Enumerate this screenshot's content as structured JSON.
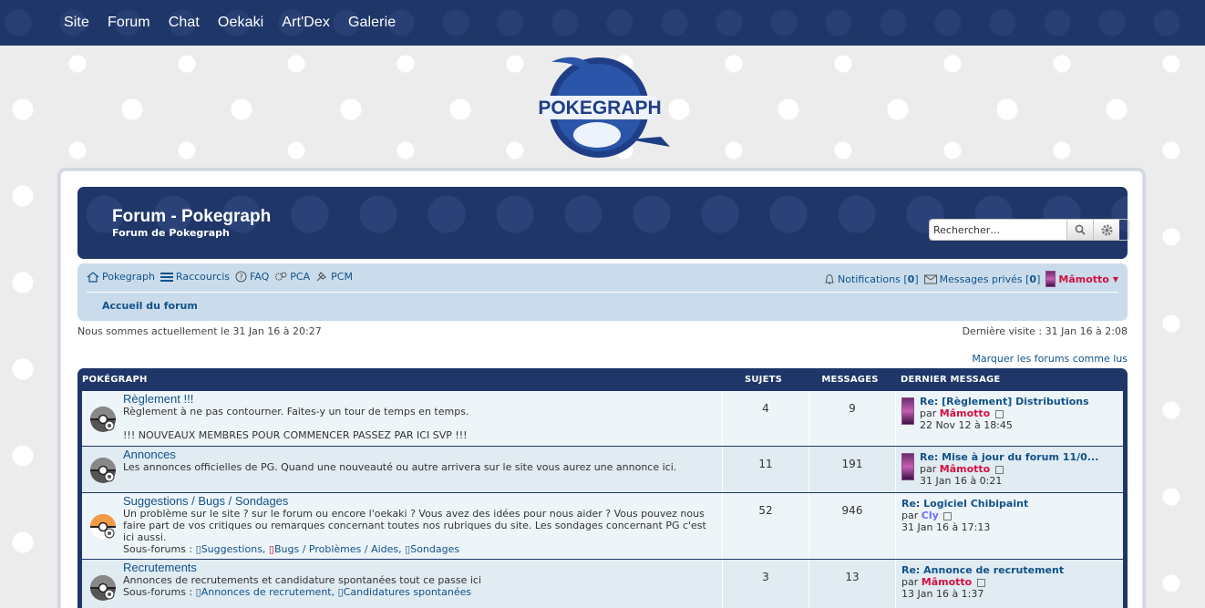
{
  "topnav": [
    "Site",
    "Forum",
    "Chat",
    "Oekaki",
    "Art'Dex",
    "Galerie"
  ],
  "logo_text": "POKEGRAPH",
  "header": {
    "title": "Forum - Pokegraph",
    "description": "Forum de Pokegraph",
    "search_placeholder": "Rechercher…"
  },
  "navbar": {
    "links": [
      "Pokegraph",
      "Raccourcis",
      "FAQ",
      "PCA",
      "PCM"
    ],
    "notifications_label": "Notifications",
    "notifications_count": "0",
    "messages_label": "Messages privés",
    "messages_count": "0",
    "username": "Mâmotto",
    "breadcrumb": "Accueil du forum"
  },
  "info": {
    "current_time": "Nous sommes actuellement le 31 Jan 16 à 20:27",
    "last_visit": "Dernière visite : 31 Jan 16 à 2:08",
    "mark_read": "Marquer les forums comme lus"
  },
  "forum_table": {
    "category": "POKÉGRAPH",
    "col_topics": "SUJETS",
    "col_posts": "MESSAGES",
    "col_last": "DERNIER MESSAGE",
    "subforums_label": "Sous-forums :",
    "by_label": "par",
    "rows": [
      {
        "title": "Règlement !!!",
        "desc": "Règlement à ne pas contourner. Faites-y un tour de temps en temps.",
        "desc2": "!!! NOUVEAUX MEMBRES POUR COMMENCER PASSEZ PAR ICI SVP !!!",
        "topics": "4",
        "posts": "9",
        "last_title": "Re: [Règlement] Distributions",
        "last_user": "Mâmotto",
        "last_date": "22 Nov 12 à 18:45"
      },
      {
        "title": "Annonces",
        "desc": "Les annonces officielles de PG. Quand une nouveauté ou autre arrivera sur le site vous aurez une annonce ici.",
        "topics": "11",
        "posts": "191",
        "last_title": "Re: Mise à jour du forum 11/0...",
        "last_user": "Mâmotto",
        "last_date": "31 Jan 16 à 0:21"
      },
      {
        "title": "Suggestions / Bugs / Sondages",
        "desc": "Un problème sur le site ? sur le forum ou encore l'oekaki ? Vous avez des idées pour nous aider ? Vous pouvez nous faire part de vos critiques ou remarques concernant toutes nos rubriques du site. Les sondages concernant PG c'est ici aussi.",
        "subforums": [
          "Suggestions,",
          "Bugs / Problèmes / Aides,",
          "Sondages"
        ],
        "topics": "52",
        "posts": "946",
        "last_title": "Re: Logiciel Chibipaint",
        "last_user": "Cly",
        "last_date": "31 Jan 16 à 17:13"
      },
      {
        "title": "Recrutements",
        "desc": "Annonces de recrutements et candidature spontanées tout ce passe ici",
        "subforums": [
          "Annonces de recrutement,",
          "Candidatures spontanées"
        ],
        "topics": "3",
        "posts": "13",
        "last_title": "Re: Annonce de recrutement",
        "last_user": "Mâmotto",
        "last_date": "13 Jan 16 à 1:37"
      }
    ]
  }
}
